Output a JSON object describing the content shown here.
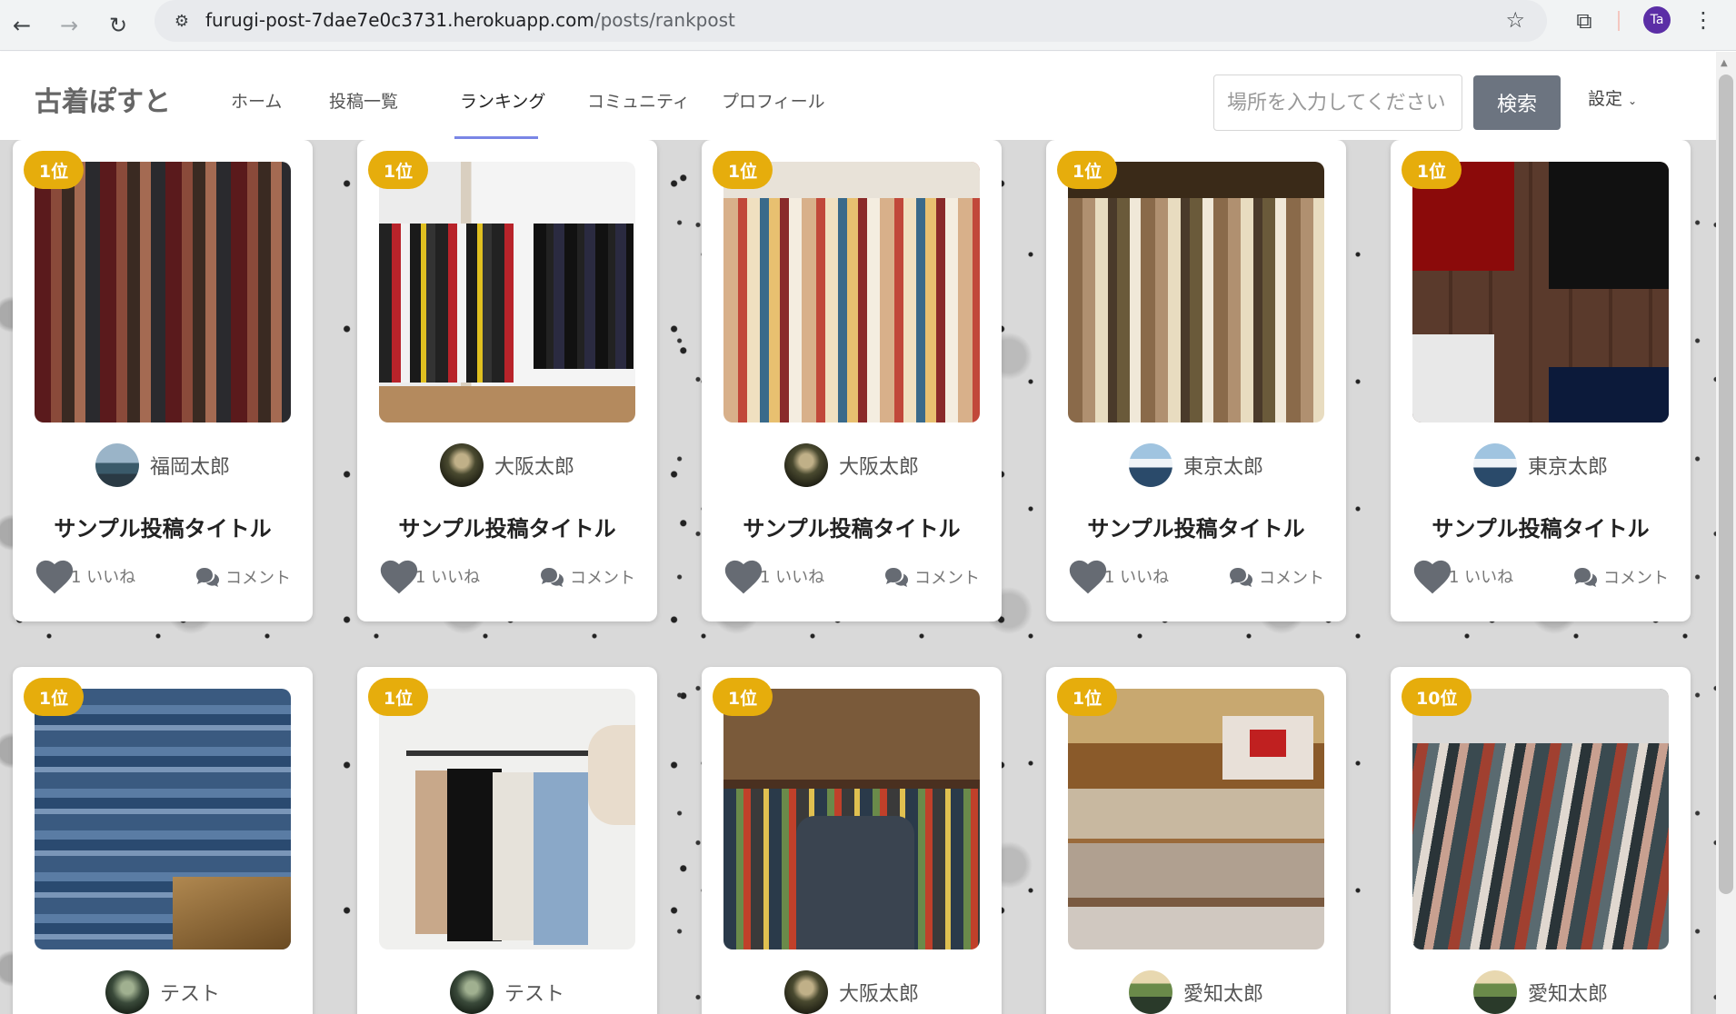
{
  "browser": {
    "url_host": "furugi-post-7dae7e0c3731.herokuapp.com",
    "url_path": "/posts/rankpost",
    "profile_initials": "Ta"
  },
  "site": {
    "logo": "古着ぽすと",
    "nav": [
      "ホーム",
      "投稿一覧",
      "ランキング",
      "コミュニティ",
      "プロフィール"
    ],
    "active_nav": "ランキング",
    "search_placeholder": "場所を入力してください",
    "search_button": "検索",
    "settings_label": "設定"
  },
  "posts": [
    {
      "rank": "1位",
      "user": "福岡太郎",
      "title": "サンプル投稿タイトル",
      "likes": "1 いいね",
      "comments": "コメント",
      "photo": "p1",
      "avatar": "a-lake"
    },
    {
      "rank": "1位",
      "user": "大阪太郎",
      "title": "サンプル投稿タイトル",
      "likes": "1 いいね",
      "comments": "コメント",
      "photo": "p2",
      "avatar": "a-forest"
    },
    {
      "rank": "1位",
      "user": "大阪太郎",
      "title": "サンプル投稿タイトル",
      "likes": "1 いいね",
      "comments": "コメント",
      "photo": "p3",
      "avatar": "a-forest"
    },
    {
      "rank": "1位",
      "user": "東京太郎",
      "title": "サンプル投稿タイトル",
      "likes": "1 いいね",
      "comments": "コメント",
      "photo": "p4",
      "avatar": "a-mountain"
    },
    {
      "rank": "1位",
      "user": "東京太郎",
      "title": "サンプル投稿タイトル",
      "likes": "1 いいね",
      "comments": "コメント",
      "photo": "p5",
      "avatar": "a-mountain"
    },
    {
      "rank": "1位",
      "user": "テスト",
      "photo": "p6",
      "avatar": "a-dark"
    },
    {
      "rank": "1位",
      "user": "テスト",
      "photo": "p7",
      "avatar": "a-dark"
    },
    {
      "rank": "1位",
      "user": "大阪太郎",
      "photo": "p8",
      "avatar": "a-forest"
    },
    {
      "rank": "1位",
      "user": "愛知太郎",
      "photo": "p9",
      "avatar": "a-valley"
    },
    {
      "rank": "10位",
      "user": "愛知太郎",
      "photo": "p10",
      "avatar": "a-valley"
    }
  ]
}
